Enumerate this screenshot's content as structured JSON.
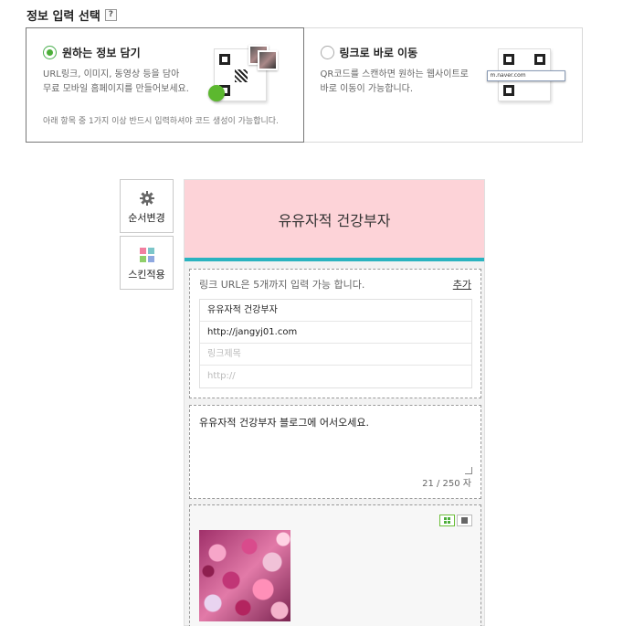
{
  "section": {
    "title": "정보 입력 선택",
    "help": "?"
  },
  "options": [
    {
      "label": "원하는 정보 담기",
      "selected": true,
      "desc1": "URL링크, 이미지, 동영상 등을 담아",
      "desc2": "무료 모바일 홈페이지를 만들어보세요.",
      "note": "아래 항목 중 1가지 이상 반드시 입력하셔야 코드 생성이 가능합니다."
    },
    {
      "label": "링크로 바로 이동",
      "selected": false,
      "desc1": "QR코드를 스캔하면 원하는 웹사이트로",
      "desc2": "바로 이동이 가능합니다.",
      "url_sample": "m.naver.com"
    }
  ],
  "sidebar": {
    "reorder_label": "순서변경",
    "skin_label": "스킨적용"
  },
  "preview": {
    "header_title": "유유자적 건강부자",
    "link_block": {
      "hint": "링크 URL은 5개까지 입력 가능 합니다.",
      "add_label": "추가",
      "rows": [
        {
          "value": "유유자적 건강부자",
          "placeholder": ""
        },
        {
          "value": "http://jangyj01.com",
          "placeholder": ""
        },
        {
          "value": "",
          "placeholder": "링크제목"
        },
        {
          "value": "",
          "placeholder": "http://"
        }
      ]
    },
    "text_block": {
      "text": "유유자적 건강부자 블로그에 어서오세요.",
      "counter": "21 / 250 자"
    }
  },
  "colors": {
    "header_bg": "#fdd3d8",
    "accent_line": "#2ab3c0",
    "radio_on": "#4cae3a"
  }
}
